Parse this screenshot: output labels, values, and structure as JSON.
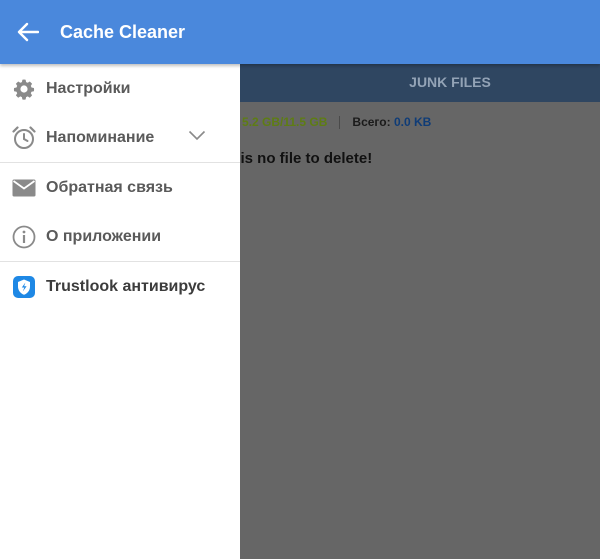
{
  "appbar": {
    "title": "Cache Cleaner",
    "back_icon": "arrow-left-icon",
    "color": "#4a88dc"
  },
  "background": {
    "tab_label": "JUNK FILES",
    "storage_label_fragment": "e:",
    "storage_value": "5.2 GB/11.5 GB",
    "total_label": "Всего:",
    "total_value": "0.0 KB",
    "empty_message_fragment": "e is no file to delete!"
  },
  "drawer": {
    "items": [
      {
        "label": "Настройки",
        "icon": "gear-icon"
      },
      {
        "label": "Напоминание",
        "icon": "alarm-clock-icon",
        "expand_icon": "chevron-down-icon"
      },
      {
        "label": "Обратная связь",
        "icon": "envelope-icon"
      },
      {
        "label": "О приложении",
        "icon": "info-icon"
      },
      {
        "label": "Trustlook антивирус",
        "icon": "trustlook-shield-icon"
      }
    ]
  }
}
